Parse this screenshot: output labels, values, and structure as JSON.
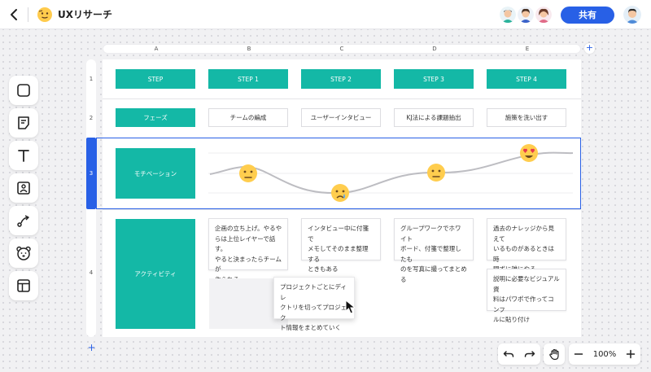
{
  "header": {
    "title": "UXリサーチ",
    "share_label": "共有",
    "collaborators": [
      "avatar-1",
      "avatar-2",
      "avatar-3"
    ]
  },
  "toolbar": {
    "tools": [
      "shape-icon",
      "sticky-note-icon",
      "text-icon",
      "image-icon",
      "connector-icon",
      "stamp-icon",
      "template-icon"
    ]
  },
  "grid": {
    "columns": [
      "A",
      "B",
      "C",
      "D",
      "E"
    ],
    "rows": [
      "1",
      "2",
      "3",
      "4"
    ],
    "step_row": [
      "STEP",
      "STEP 1",
      "STEP 2",
      "STEP 3",
      "STEP 4"
    ],
    "phase_row": [
      "フェーズ",
      "チームの編成",
      "ユーザーインタビュー",
      "KJ法による課題抽出",
      "施策を洗い出す"
    ],
    "motivation_label": "モチベーション",
    "motivation_levels": [
      "neutral",
      "sad",
      "neutral",
      "love"
    ],
    "activity_label": "アクティビティ",
    "activities": {
      "b1": [
        "企画の立ち上げ。やるやらは上位レイヤーで話す。",
        "やると決まったらチームが",
        "作られる"
      ],
      "c1": [
        "インタビュー中に付箋で",
        "メモしてそのまま整理する",
        "ときもある"
      ],
      "d1": [
        "グループワークでホワイト",
        "ボード、付箋で整理したも",
        "のを写真に撮ってまとめる"
      ],
      "e1": [
        "過去のナレッジから見えて",
        "いるものがあるときは時",
        "間ずに雑にやる"
      ],
      "e2": [
        "説明に必要なビジュアル資",
        "料はパワポで作ってコンフ",
        "ルに貼り付け"
      ],
      "dragging": [
        "プロジェクトごとにディレ",
        "クトリを切ってプロジェク",
        "ト情報をまとめていく"
      ]
    }
  },
  "controls": {
    "zoom": "100%",
    "undo": "undo-icon",
    "redo": "redo-icon",
    "hand": "hand-icon"
  },
  "colors": {
    "accent": "#2860e6",
    "teal": "#14b8a6"
  }
}
